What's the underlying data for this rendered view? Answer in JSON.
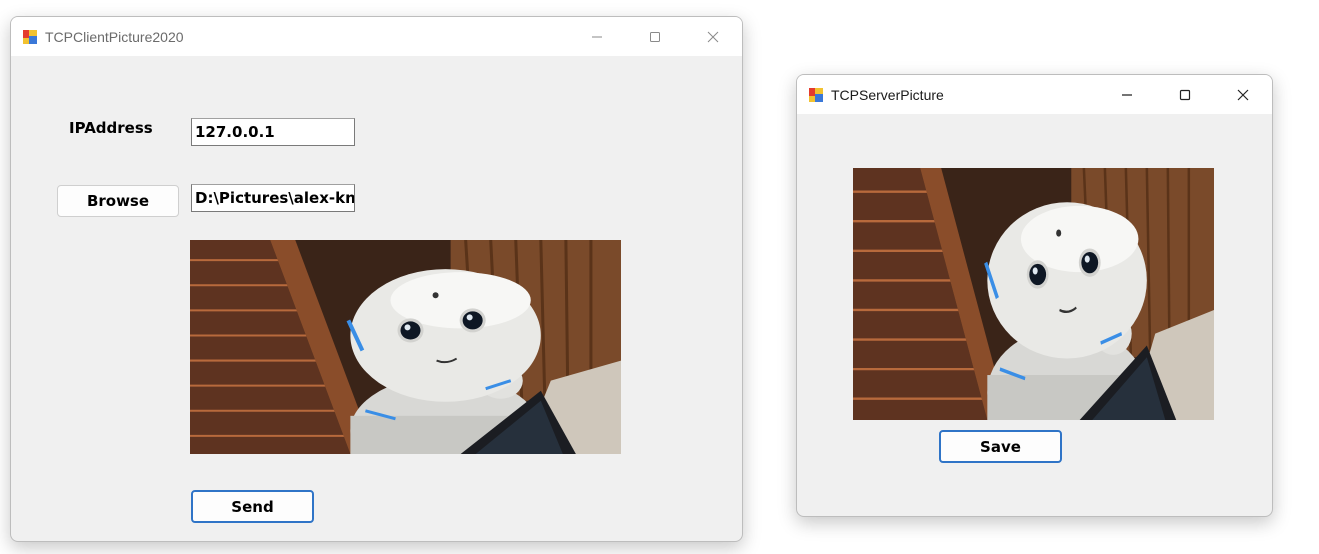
{
  "client_window": {
    "title": "TCPClientPicture2020",
    "ip_label": "IPAddress",
    "ip_value": "127.0.0.1",
    "browse_label": "Browse",
    "path_value": "D:\\Pictures\\alex-kn",
    "send_label": "Send",
    "icons": [
      "app-icon",
      "minimize-icon",
      "maximize-icon",
      "close-icon"
    ]
  },
  "server_window": {
    "title": "TCPServerPicture",
    "save_label": "Save",
    "icons": [
      "app-icon",
      "minimize-icon",
      "maximize-icon",
      "close-icon"
    ]
  },
  "colors": {
    "window_bg": "#f0f0f0",
    "titlebar_bg": "#ffffff",
    "focus_border": "#2f74c7"
  }
}
